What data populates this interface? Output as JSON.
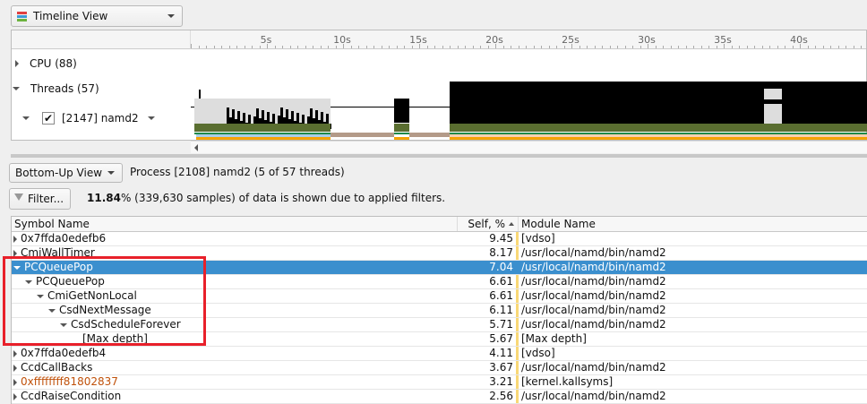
{
  "top": {
    "view_selector": "Timeline View"
  },
  "timeline": {
    "ticks": [
      "5s",
      "10s",
      "15s",
      "20s",
      "25s",
      "30s",
      "35s",
      "40s"
    ],
    "rows": [
      {
        "label": "CPU (88)",
        "expanded": false
      },
      {
        "label": "Threads (57)",
        "expanded": true
      },
      {
        "label": "[2147] namd2",
        "checked": true,
        "expanded": true
      }
    ]
  },
  "bottom": {
    "view_selector": "Bottom-Up View",
    "process_label": "Process [2108] namd2 (5 of 57 threads)",
    "filter_button": "Filter...",
    "filter_pct": "11.84",
    "filter_text": "% (339,630 samples) of data is shown due to applied filters."
  },
  "table": {
    "headers": {
      "symbol": "Symbol Name",
      "self": "Self, %",
      "module": "Module Name"
    },
    "rows": [
      {
        "symbol": "0x7ffda0edefb6",
        "self": "9.45",
        "module": "[vdso]",
        "depth": 0,
        "toggle": "collapsed"
      },
      {
        "symbol": "CmiWallTimer",
        "self": "8.17",
        "module": "/usr/local/namd/bin/namd2",
        "depth": 0,
        "toggle": "collapsed"
      },
      {
        "symbol": "PCQueuePop",
        "self": "7.04",
        "module": "/usr/local/namd/bin/namd2",
        "depth": 0,
        "toggle": "expanded",
        "selected": true
      },
      {
        "symbol": "PCQueuePop",
        "self": "6.61",
        "module": "/usr/local/namd/bin/namd2",
        "depth": 1,
        "toggle": "expanded"
      },
      {
        "symbol": "CmiGetNonLocal",
        "self": "6.61",
        "module": "/usr/local/namd/bin/namd2",
        "depth": 2,
        "toggle": "expanded"
      },
      {
        "symbol": "CsdNextMessage",
        "self": "6.11",
        "module": "/usr/local/namd/bin/namd2",
        "depth": 3,
        "toggle": "expanded"
      },
      {
        "symbol": "CsdScheduleForever",
        "self": "5.71",
        "module": "/usr/local/namd/bin/namd2",
        "depth": 4,
        "toggle": "expanded"
      },
      {
        "symbol": "[Max depth]",
        "self": "5.67",
        "module": "[Max depth]",
        "depth": 5,
        "toggle": "none"
      },
      {
        "symbol": "0x7ffda0edefb4",
        "self": "4.11",
        "module": "[vdso]",
        "depth": 0,
        "toggle": "collapsed"
      },
      {
        "symbol": "CcdCallBacks",
        "self": "3.67",
        "module": "/usr/local/namd/bin/namd2",
        "depth": 0,
        "toggle": "collapsed"
      },
      {
        "symbol": "0xffffffff81802837",
        "self": "3.21",
        "module": "[kernel.kallsyms]",
        "depth": 0,
        "toggle": "collapsed",
        "kernel": true
      },
      {
        "symbol": "CcdRaiseCondition",
        "self": "2.56",
        "module": "/usr/local/namd/bin/namd2",
        "depth": 0,
        "toggle": "collapsed"
      }
    ]
  },
  "colors": {
    "selection": "#3b8fce",
    "highlight_box": "#e8202a",
    "kernel_text": "#c0510a",
    "self_bar": "#f9d876"
  }
}
